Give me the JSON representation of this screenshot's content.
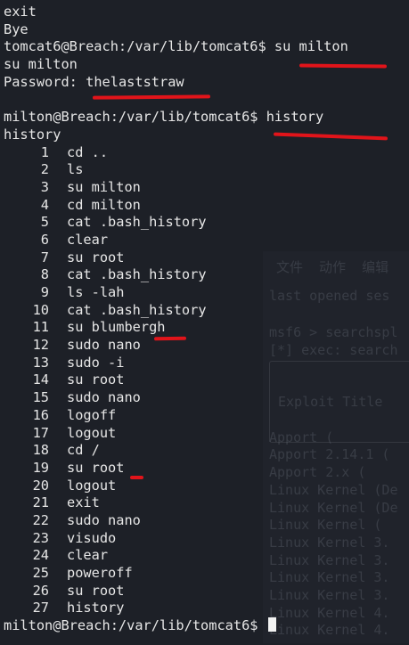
{
  "terminal": {
    "pre_lines": [
      "exit",
      "Bye",
      "tomcat6@Breach:/var/lib/tomcat6$ su milton",
      "su milton"
    ],
    "password_label": "Password: ",
    "password_value": "thelaststraw",
    "history_command_line": "milton@Breach:/var/lib/tomcat6$ history",
    "history_echo": "history",
    "history": [
      {
        "n": "1",
        "cmd": "cd .."
      },
      {
        "n": "2",
        "cmd": "ls"
      },
      {
        "n": "3",
        "cmd": "su milton"
      },
      {
        "n": "4",
        "cmd": "cd milton"
      },
      {
        "n": "5",
        "cmd": "cat .bash_history"
      },
      {
        "n": "6",
        "cmd": "clear"
      },
      {
        "n": "7",
        "cmd": "su root"
      },
      {
        "n": "8",
        "cmd": "cat .bash_history"
      },
      {
        "n": "9",
        "cmd": "ls -lah"
      },
      {
        "n": "10",
        "cmd": "cat .bash_history"
      },
      {
        "n": "11",
        "cmd": "su blumbergh"
      },
      {
        "n": "12",
        "cmd": "sudo nano"
      },
      {
        "n": "13",
        "cmd": "sudo -i"
      },
      {
        "n": "14",
        "cmd": "su root"
      },
      {
        "n": "15",
        "cmd": "sudo nano"
      },
      {
        "n": "16",
        "cmd": "logoff"
      },
      {
        "n": "17",
        "cmd": "logout"
      },
      {
        "n": "18",
        "cmd": "cd /"
      },
      {
        "n": "19",
        "cmd": "su root"
      },
      {
        "n": "20",
        "cmd": "logout"
      },
      {
        "n": "21",
        "cmd": "exit"
      },
      {
        "n": "22",
        "cmd": "sudo nano"
      },
      {
        "n": "23",
        "cmd": "visudo"
      },
      {
        "n": "24",
        "cmd": "clear"
      },
      {
        "n": "25",
        "cmd": "poweroff"
      },
      {
        "n": "26",
        "cmd": "su root"
      },
      {
        "n": "27",
        "cmd": "history"
      }
    ],
    "final_prompt": "milton@Breach:/var/lib/tomcat6$ "
  },
  "background_window": {
    "lines": [
      "文件  动作  编辑",
      "last opened ses",
      "msf6 > searchspl",
      "[*] exec: search",
      "Exploit Title",
      "Apport (",
      "Apport 2.14.1 (",
      "Apport 2.x (",
      "Linux Kernel (De",
      "Linux Kernel (De",
      "Linux Kernel (",
      "Linux Kernel 3.",
      "Linux Kernel 3.",
      "Linux Kernel 3.",
      "Linux Kernel 3.",
      "Linux Kernel 4.",
      "Linux Kernel 4."
    ]
  },
  "colors": {
    "background": "#1d2027",
    "text": "#e6e6e6",
    "annotation": "#e1141a"
  }
}
